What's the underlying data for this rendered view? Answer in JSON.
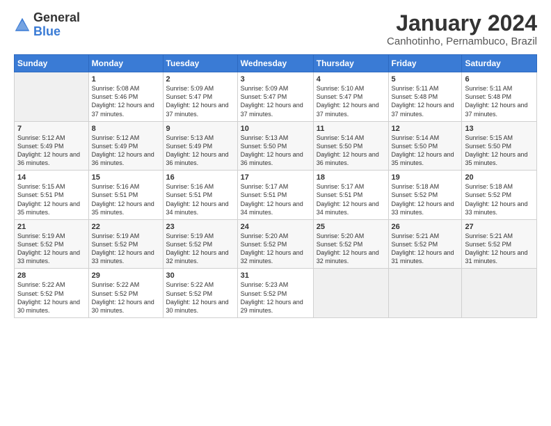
{
  "logo": {
    "general": "General",
    "blue": "Blue"
  },
  "title": "January 2024",
  "subtitle": "Canhotinho, Pernambuco, Brazil",
  "days_header": [
    "Sunday",
    "Monday",
    "Tuesday",
    "Wednesday",
    "Thursday",
    "Friday",
    "Saturday"
  ],
  "weeks": [
    [
      {
        "day": "",
        "sunrise": "",
        "sunset": "",
        "daylight": ""
      },
      {
        "day": "1",
        "sunrise": "5:08 AM",
        "sunset": "5:46 PM",
        "daylight": "12 hours and 37 minutes."
      },
      {
        "day": "2",
        "sunrise": "5:09 AM",
        "sunset": "5:47 PM",
        "daylight": "12 hours and 37 minutes."
      },
      {
        "day": "3",
        "sunrise": "5:09 AM",
        "sunset": "5:47 PM",
        "daylight": "12 hours and 37 minutes."
      },
      {
        "day": "4",
        "sunrise": "5:10 AM",
        "sunset": "5:47 PM",
        "daylight": "12 hours and 37 minutes."
      },
      {
        "day": "5",
        "sunrise": "5:11 AM",
        "sunset": "5:48 PM",
        "daylight": "12 hours and 37 minutes."
      },
      {
        "day": "6",
        "sunrise": "5:11 AM",
        "sunset": "5:48 PM",
        "daylight": "12 hours and 37 minutes."
      }
    ],
    [
      {
        "day": "7",
        "sunrise": "5:12 AM",
        "sunset": "5:49 PM",
        "daylight": "12 hours and 36 minutes."
      },
      {
        "day": "8",
        "sunrise": "5:12 AM",
        "sunset": "5:49 PM",
        "daylight": "12 hours and 36 minutes."
      },
      {
        "day": "9",
        "sunrise": "5:13 AM",
        "sunset": "5:49 PM",
        "daylight": "12 hours and 36 minutes."
      },
      {
        "day": "10",
        "sunrise": "5:13 AM",
        "sunset": "5:50 PM",
        "daylight": "12 hours and 36 minutes."
      },
      {
        "day": "11",
        "sunrise": "5:14 AM",
        "sunset": "5:50 PM",
        "daylight": "12 hours and 36 minutes."
      },
      {
        "day": "12",
        "sunrise": "5:14 AM",
        "sunset": "5:50 PM",
        "daylight": "12 hours and 35 minutes."
      },
      {
        "day": "13",
        "sunrise": "5:15 AM",
        "sunset": "5:50 PM",
        "daylight": "12 hours and 35 minutes."
      }
    ],
    [
      {
        "day": "14",
        "sunrise": "5:15 AM",
        "sunset": "5:51 PM",
        "daylight": "12 hours and 35 minutes."
      },
      {
        "day": "15",
        "sunrise": "5:16 AM",
        "sunset": "5:51 PM",
        "daylight": "12 hours and 35 minutes."
      },
      {
        "day": "16",
        "sunrise": "5:16 AM",
        "sunset": "5:51 PM",
        "daylight": "12 hours and 34 minutes."
      },
      {
        "day": "17",
        "sunrise": "5:17 AM",
        "sunset": "5:51 PM",
        "daylight": "12 hours and 34 minutes."
      },
      {
        "day": "18",
        "sunrise": "5:17 AM",
        "sunset": "5:51 PM",
        "daylight": "12 hours and 34 minutes."
      },
      {
        "day": "19",
        "sunrise": "5:18 AM",
        "sunset": "5:52 PM",
        "daylight": "12 hours and 33 minutes."
      },
      {
        "day": "20",
        "sunrise": "5:18 AM",
        "sunset": "5:52 PM",
        "daylight": "12 hours and 33 minutes."
      }
    ],
    [
      {
        "day": "21",
        "sunrise": "5:19 AM",
        "sunset": "5:52 PM",
        "daylight": "12 hours and 33 minutes."
      },
      {
        "day": "22",
        "sunrise": "5:19 AM",
        "sunset": "5:52 PM",
        "daylight": "12 hours and 33 minutes."
      },
      {
        "day": "23",
        "sunrise": "5:19 AM",
        "sunset": "5:52 PM",
        "daylight": "12 hours and 32 minutes."
      },
      {
        "day": "24",
        "sunrise": "5:20 AM",
        "sunset": "5:52 PM",
        "daylight": "12 hours and 32 minutes."
      },
      {
        "day": "25",
        "sunrise": "5:20 AM",
        "sunset": "5:52 PM",
        "daylight": "12 hours and 32 minutes."
      },
      {
        "day": "26",
        "sunrise": "5:21 AM",
        "sunset": "5:52 PM",
        "daylight": "12 hours and 31 minutes."
      },
      {
        "day": "27",
        "sunrise": "5:21 AM",
        "sunset": "5:52 PM",
        "daylight": "12 hours and 31 minutes."
      }
    ],
    [
      {
        "day": "28",
        "sunrise": "5:22 AM",
        "sunset": "5:52 PM",
        "daylight": "12 hours and 30 minutes."
      },
      {
        "day": "29",
        "sunrise": "5:22 AM",
        "sunset": "5:52 PM",
        "daylight": "12 hours and 30 minutes."
      },
      {
        "day": "30",
        "sunrise": "5:22 AM",
        "sunset": "5:52 PM",
        "daylight": "12 hours and 30 minutes."
      },
      {
        "day": "31",
        "sunrise": "5:23 AM",
        "sunset": "5:52 PM",
        "daylight": "12 hours and 29 minutes."
      },
      {
        "day": "",
        "sunrise": "",
        "sunset": "",
        "daylight": ""
      },
      {
        "day": "",
        "sunrise": "",
        "sunset": "",
        "daylight": ""
      },
      {
        "day": "",
        "sunrise": "",
        "sunset": "",
        "daylight": ""
      }
    ]
  ],
  "labels": {
    "sunrise": "Sunrise:",
    "sunset": "Sunset:",
    "daylight_prefix": "Daylight: 12 hours"
  }
}
